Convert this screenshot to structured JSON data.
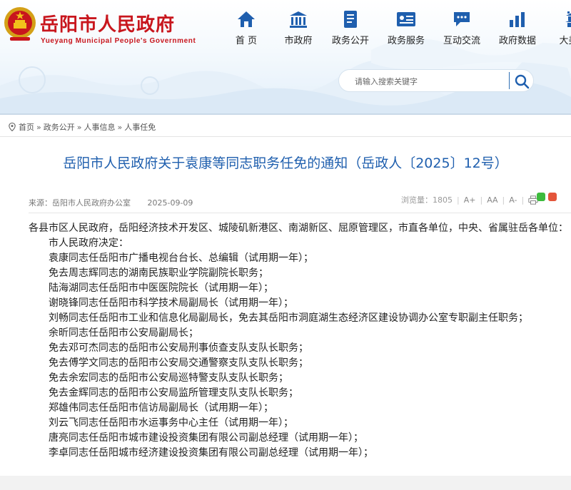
{
  "header": {
    "title": "岳阳市人民政府",
    "subtitle": "Yueyang Municipal People's Government",
    "emblem_icon": "national-emblem-icon",
    "brand_color": "#c8161d",
    "nav_color": "#1f5fae"
  },
  "nav": {
    "items": [
      {
        "label": "首 页",
        "icon": "home-icon"
      },
      {
        "label": "市政府",
        "icon": "government-building-icon"
      },
      {
        "label": "政务公开",
        "icon": "document-icon"
      },
      {
        "label": "政务服务",
        "icon": "service-card-icon"
      },
      {
        "label": "互动交流",
        "icon": "chat-icon"
      },
      {
        "label": "政府数据",
        "icon": "bar-chart-icon"
      },
      {
        "label": "大美岳",
        "icon": "scenery-icon"
      }
    ]
  },
  "search": {
    "placeholder": "请输入搜索关键字",
    "icon": "search-icon"
  },
  "breadcrumb": {
    "items": [
      "首页",
      "政务公开",
      "人事信息",
      "人事任免"
    ],
    "separator": "»",
    "icon": "location-icon"
  },
  "article": {
    "title": "岳阳市人民政府关于袁康等同志职务任免的通知（岳政人〔2025〕12号）",
    "source": "来源：岳阳市人民政府办公室",
    "date": "2025-09-09",
    "views": "浏览量：1805",
    "font_increase": "A+",
    "font_reset": "AA",
    "font_decrease": "A-",
    "print_icon": "print-icon",
    "share_icons": [
      "wechat-icon",
      "weibo-icon"
    ],
    "intro": "各县市区人民政府，岳阳经济技术开发区、城陵矶新港区、南湖新区、屈原管理区，市直各单位，中央、省属驻岳各单位：",
    "paragraphs": [
      "市人民政府决定：",
      "袁康同志任岳阳市广播电视台台长、总编辑（试用期一年）；",
      "免去周志辉同志的湖南民族职业学院副院长职务；",
      "陆海湖同志任岳阳市中医医院院长（试用期一年）；",
      "谢晓锋同志任岳阳市科学技术局副局长（试用期一年）；",
      "刘畅同志任岳阳市工业和信息化局副局长，免去其岳阳市洞庭湖生态经济区建设协调办公室专职副主任职务；",
      "余昕同志任岳阳市公安局副局长；",
      "免去邓可杰同志的岳阳市公安局刑事侦查支队支队长职务；",
      "免去傅学文同志的岳阳市公安局交通警察支队支队长职务；",
      "免去余宏同志的岳阳市公安局巡特警支队支队长职务；",
      "免去金辉同志的岳阳市公安局监所管理支队支队长职务；",
      "郑雄伟同志任岳阳市信访局副局长（试用期一年）；",
      "刘云飞同志任岳阳市水运事务中心主任（试用期一年）；",
      "唐亮同志任岳阳市城市建设投资集团有限公司副总经理（试用期一年）；",
      "李卓同志任岳阳城市经济建设投资集团有限公司副总经理（试用期一年）；"
    ]
  }
}
